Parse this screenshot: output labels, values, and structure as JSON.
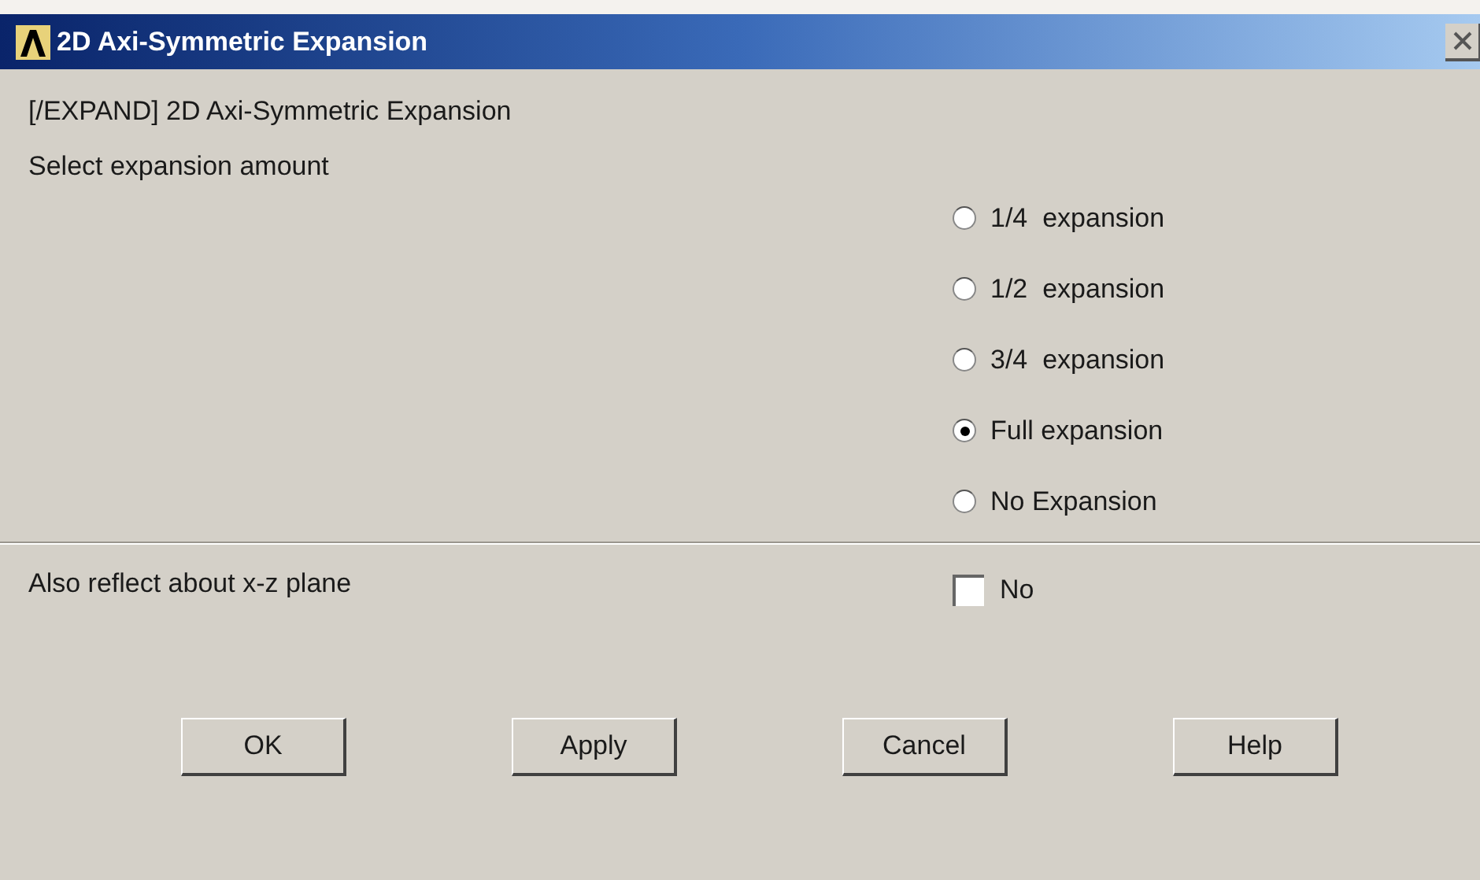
{
  "window": {
    "title": "2D Axi-Symmetric Expansion"
  },
  "command": "[/EXPAND] 2D Axi-Symmetric Expansion",
  "prompt": "Select expansion amount",
  "options": [
    {
      "label": "1/4  expansion",
      "selected": false
    },
    {
      "label": "1/2  expansion",
      "selected": false
    },
    {
      "label": "3/4  expansion",
      "selected": false
    },
    {
      "label": "Full expansion",
      "selected": true
    },
    {
      "label": "No Expansion",
      "selected": false
    }
  ],
  "reflect": {
    "label": "Also reflect about x-z plane",
    "checkbox_label": "No",
    "checked": false
  },
  "buttons": [
    "OK",
    "Apply",
    "Cancel",
    "Help"
  ]
}
